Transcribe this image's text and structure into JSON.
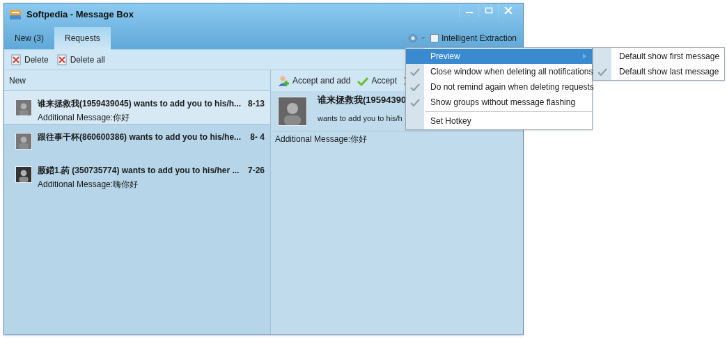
{
  "window": {
    "title": "Softpedia - Message Box"
  },
  "tabs": [
    {
      "label": "New (3)",
      "selected": false
    },
    {
      "label": "Requests",
      "selected": true
    }
  ],
  "settings": {
    "intelligent_extraction": {
      "label": "Intelligent Extraction",
      "checked": false
    }
  },
  "toolbar": [
    "Delete",
    "Delete all"
  ],
  "list": {
    "header": "New",
    "rows": [
      {
        "title": "谁来拯救我(1959439045) wants to add you to his/h...",
        "date": "8-13",
        "message": "Additional Message:你好",
        "selected": true
      },
      {
        "title": "跟往事干杯(860600386) wants to add you to his/he...",
        "date": "8- 4",
        "selected": false
      },
      {
        "title": "厫鍣1.菂 (350735774) wants to add you to his/her ...",
        "date": "7-26",
        "message": "Additional Message:嗨你好",
        "selected": false
      }
    ]
  },
  "detail": {
    "actions": [
      {
        "label": "Accept and add",
        "kind": "add"
      },
      {
        "label": "Accept",
        "kind": "accept"
      },
      {
        "kind": "decline"
      }
    ],
    "title": "谁来拯救我(19594390",
    "subtitle": "wants to add you to his/h",
    "message": "Additional Message:你好"
  },
  "menu": {
    "items": [
      {
        "label": "Preview",
        "kind": "submenu",
        "selected": true
      },
      {
        "label": "Close window when deleting all notifications",
        "kind": "check",
        "checked": true
      },
      {
        "label": "Do not remind again when deleting requests",
        "kind": "check",
        "checked": true
      },
      {
        "label": "Show groups without message flashing",
        "kind": "check",
        "checked": true
      },
      {
        "kind": "separator"
      },
      {
        "label": "Set Hotkey",
        "kind": "check",
        "checked": false
      }
    ],
    "submenu": [
      {
        "label": "Default show first message",
        "checked": false
      },
      {
        "label": "Default show last message",
        "checked": true
      }
    ]
  }
}
